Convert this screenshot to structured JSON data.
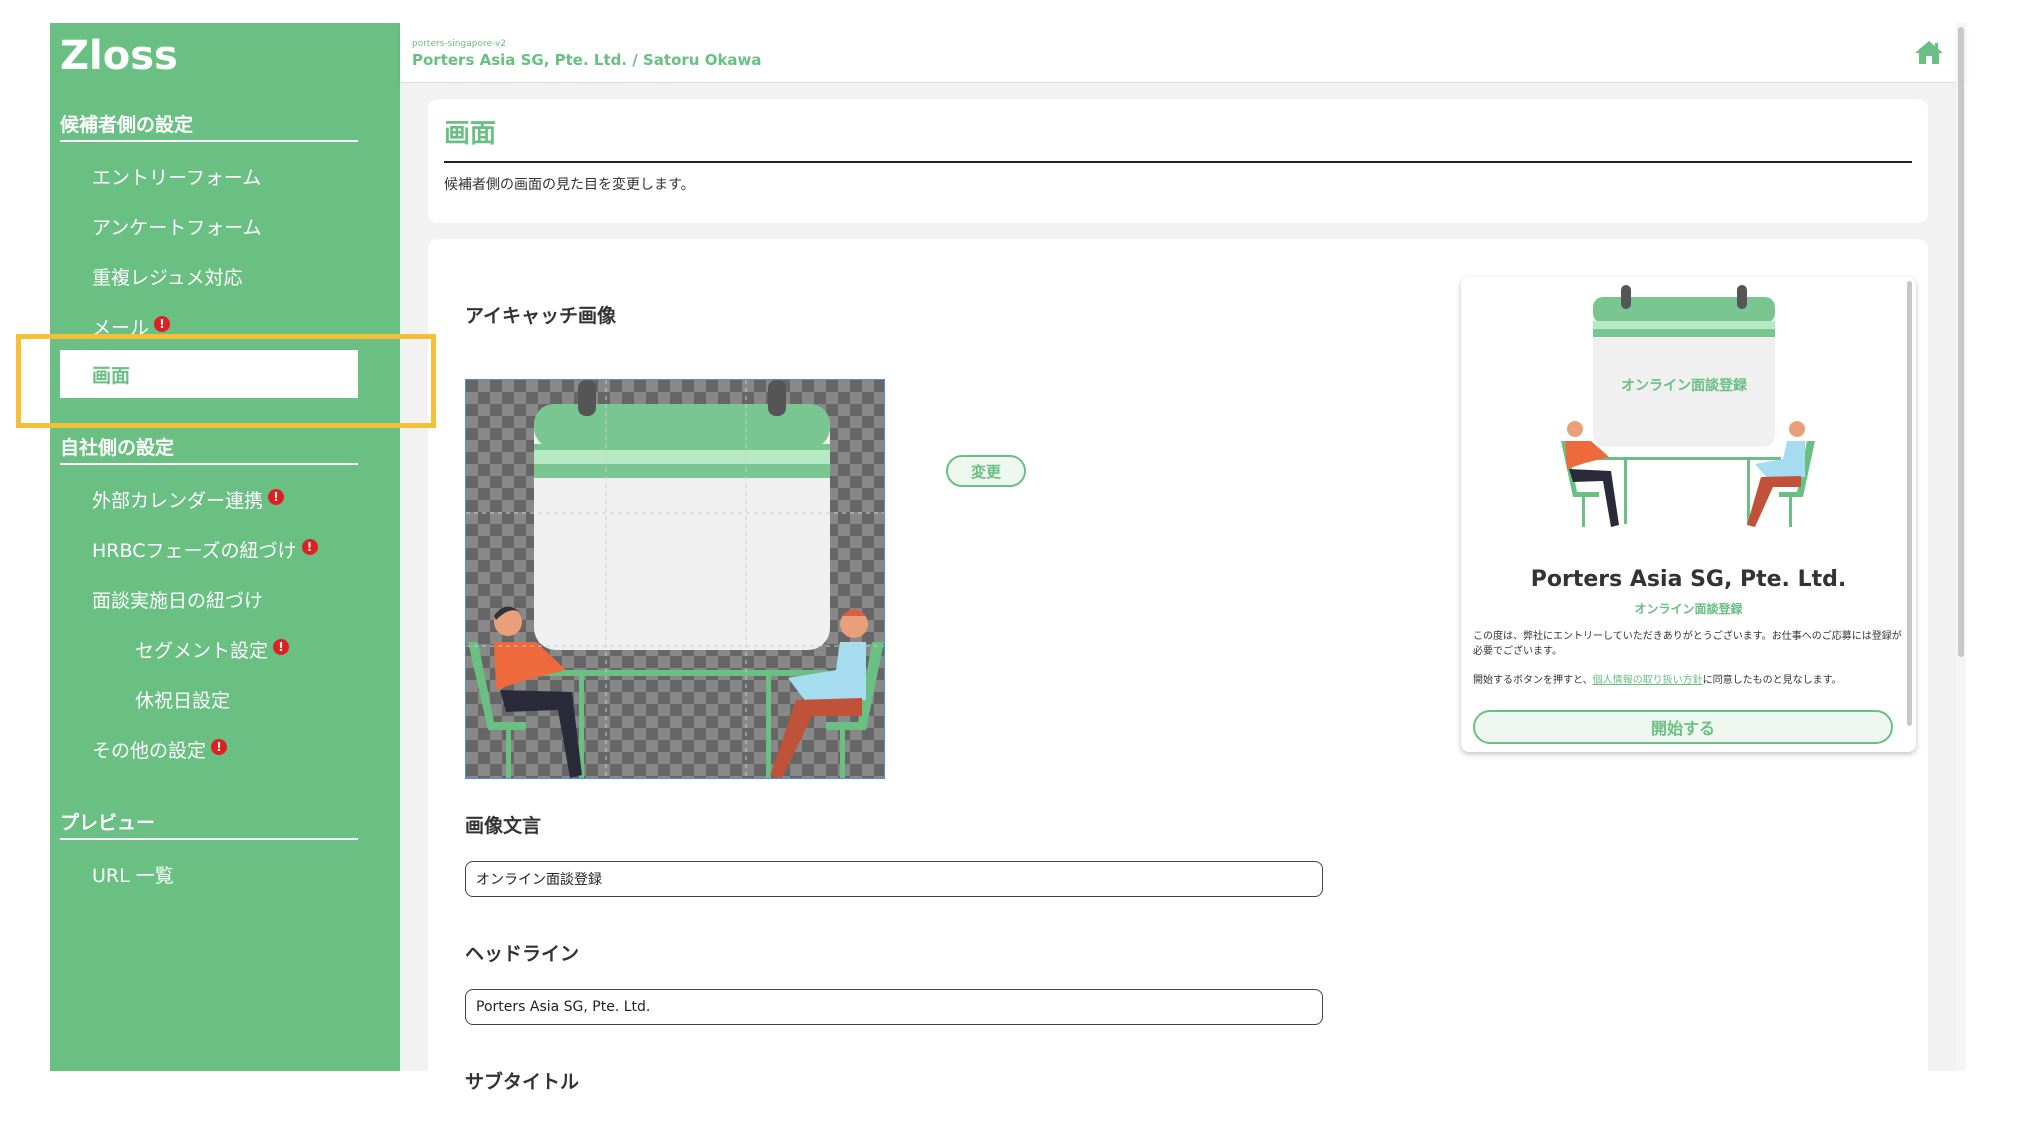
{
  "app": {
    "logo": "Zloss"
  },
  "header": {
    "org_sub": "porters-singapore-v2",
    "org_title": "Porters Asia SG, Pte. Ltd. / Satoru Okawa",
    "home_icon": "home-icon"
  },
  "sidebar": {
    "candidate_title": "候補者側の設定",
    "entry_form": "エントリーフォーム",
    "survey_form": "アンケートフォーム",
    "duplicate_resume": "重複レジュメ対応",
    "mail": "メール",
    "screen": "画面",
    "company_title": "自社側の設定",
    "external_calendar": "外部カレンダー連携",
    "hrbc_phase": "HRBCフェーズの紐づけ",
    "interview_date": "面談実施日の紐づけ",
    "segment": "セグメント設定",
    "holiday": "休祝日設定",
    "other": "その他の設定",
    "preview_title": "プレビュー",
    "url_list": "URL 一覧",
    "badge": "!"
  },
  "page": {
    "title": "画面",
    "description": "候補者側の画面の見た目を変更します。"
  },
  "form": {
    "eyecatch_label": "アイキャッチ画像",
    "change_button": "変更",
    "image_text_label": "画像文言",
    "image_text_value": "オンライン面談登録",
    "headline_label": "ヘッドライン",
    "headline_value": "Porters Asia SG, Pte. Ltd.",
    "subtitle_label": "サブタイトル"
  },
  "preview": {
    "calendar_text": "オンライン面談登録",
    "headline": "Porters Asia SG, Pte. Ltd.",
    "subtitle": "オンライン面談登録",
    "body_line1": "この度は、弊社にエントリーしていただきありがとうございます。お仕事へのご応募には登録が必要でございます。",
    "body_line2_prefix": "開始するボタンを押すと、",
    "body_line2_link": "個人情報の取り扱い方針",
    "body_line2_suffix": "に同意したものと見なします。",
    "start_button": "開始する"
  },
  "colors": {
    "accent": "#6abf83",
    "highlight": "#f5c038",
    "badge": "#e02020"
  }
}
